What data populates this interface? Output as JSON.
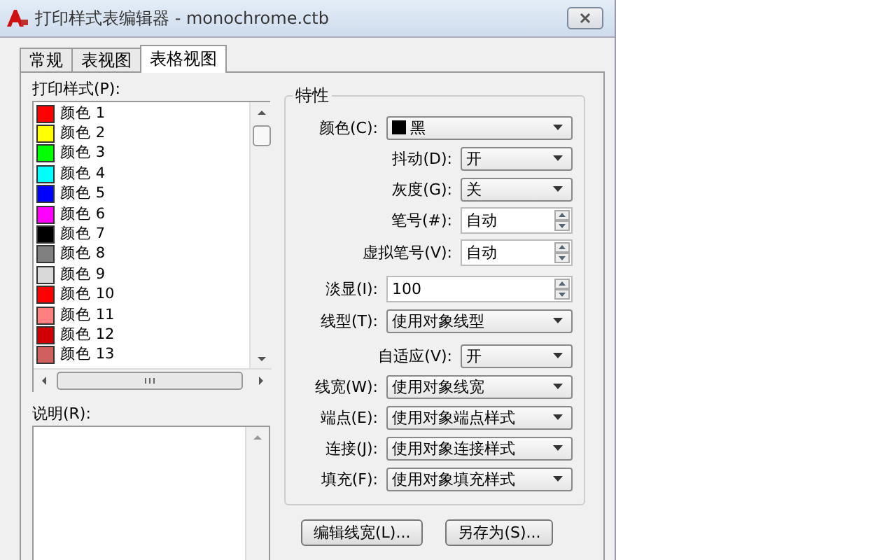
{
  "window": {
    "title": "打印样式表编辑器 - monochrome.ctb"
  },
  "tabs": [
    {
      "label": "常规",
      "selected": false
    },
    {
      "label": "表视图",
      "selected": false
    },
    {
      "label": "表格视图",
      "selected": true
    }
  ],
  "plot_styles": {
    "label": "打印样式(P):",
    "items": [
      {
        "label": "颜色 1",
        "color": "#ff0000"
      },
      {
        "label": "颜色 2",
        "color": "#ffff00"
      },
      {
        "label": "颜色 3",
        "color": "#00ff00"
      },
      {
        "label": "颜色 4",
        "color": "#00ffff"
      },
      {
        "label": "颜色 5",
        "color": "#0000ff"
      },
      {
        "label": "颜色 6",
        "color": "#ff00ff"
      },
      {
        "label": "颜色 7",
        "color": "#000000"
      },
      {
        "label": "颜色 8",
        "color": "#808080"
      },
      {
        "label": "颜色 9",
        "color": "#d9d9d9"
      },
      {
        "label": "颜色 10",
        "color": "#ff0000"
      },
      {
        "label": "颜色 11",
        "color": "#ff8080"
      },
      {
        "label": "颜色 12",
        "color": "#d00000"
      },
      {
        "label": "颜色 13",
        "color": "#d06060"
      }
    ]
  },
  "description": {
    "label": "说明(R):"
  },
  "properties": {
    "title": "特性",
    "rows": [
      {
        "label": "颜色(C):",
        "kind": "colorcombo",
        "value": "黑",
        "color": "#000000"
      },
      {
        "label": "抖动(D):",
        "kind": "combo",
        "value": "开"
      },
      {
        "label": "灰度(G):",
        "kind": "combo",
        "value": "关"
      },
      {
        "label": "笔号(#):",
        "kind": "spin",
        "value": "自动"
      },
      {
        "label": "虚拟笔号(V):",
        "kind": "spin",
        "value": "自动"
      },
      {
        "label": "淡显(I):",
        "kind": "longspin",
        "value": "100"
      },
      {
        "label": "线型(T):",
        "kind": "longcombo",
        "value": "使用对象线型"
      },
      {
        "label": "自适应(V):",
        "kind": "combo",
        "value": "开"
      },
      {
        "label": "线宽(W):",
        "kind": "longcombo",
        "value": "使用对象线宽"
      },
      {
        "label": "端点(E):",
        "kind": "longcombo",
        "value": "使用对象端点样式"
      },
      {
        "label": "连接(J):",
        "kind": "longcombo",
        "value": "使用对象连接样式"
      },
      {
        "label": "填充(F):",
        "kind": "longcombo",
        "value": "使用对象填充样式"
      }
    ]
  },
  "buttons": [
    {
      "label": "编辑线宽(L)..."
    },
    {
      "label": "另存为(S)..."
    }
  ]
}
